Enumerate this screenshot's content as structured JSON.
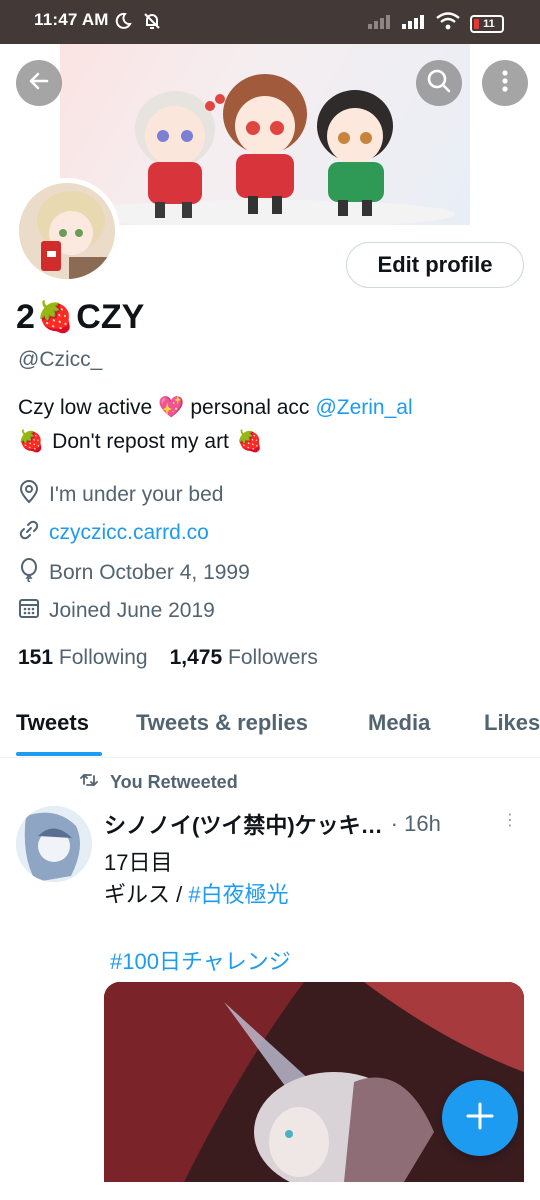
{
  "status_bar": {
    "time": "11:47 AM",
    "battery": "11",
    "icons": [
      "moon-icon",
      "notifications-muted-icon",
      "signal-icon",
      "signal-icon",
      "wifi-icon",
      "battery-icon"
    ]
  },
  "header": {
    "back_icon": "back-arrow-icon",
    "search_icon": "search-icon",
    "more_icon": "more-vertical-icon"
  },
  "profile": {
    "edit_label": "Edit profile",
    "name_prefix": "2",
    "name_emoji": "🍓",
    "name_suffix": "CZY",
    "handle": "@Czicc_",
    "bio_line1_text": "Czy low active",
    "bio_line1_emoji": "💖",
    "bio_line1_mid": "personal acc",
    "bio_mention": "@Zerin_al",
    "bio_line2_emoji": "🍓",
    "bio_line2_text": "Don't repost my art",
    "location": "I'm under your bed",
    "website": "czyczicc.carrd.co",
    "birthday": "Born October 4, 1999",
    "joined": "Joined June 2019",
    "following_count": "151",
    "following_label": "Following",
    "followers_count": "1,475",
    "followers_label": "Followers"
  },
  "tabs": [
    {
      "label": "Tweets",
      "active": true
    },
    {
      "label": "Tweets & replies",
      "active": false
    },
    {
      "label": "Media",
      "active": false
    },
    {
      "label": "Likes",
      "active": false
    }
  ],
  "tweet": {
    "retweet_label": "You Retweeted",
    "author": "シノノイ(ツイ禁中)ケッキ…",
    "time": "· 16h",
    "more": "⋮",
    "line1": "17日目",
    "line2_prefix": "ギルス / ",
    "line2_hashtag": "#白夜極光",
    "hashtag2": "#100日チャレンジ"
  },
  "colors": {
    "accent": "#1d9bf0",
    "status_bar": "#433a37",
    "secondary_text": "#536471"
  }
}
